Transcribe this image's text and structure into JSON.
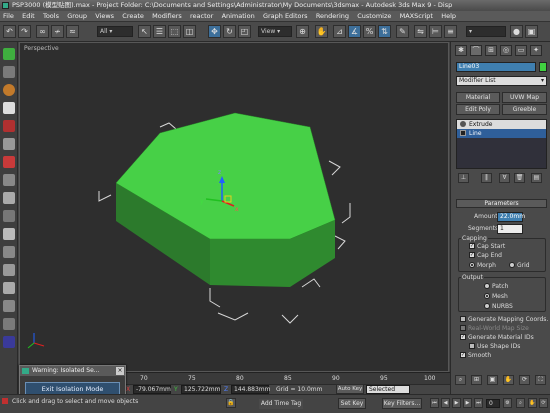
{
  "window": {
    "title": "PSP3000 (模型贴图).max  - Project Folder: C:\\Documents and Settings\\Administrator\\My Documents\\3dsmax  - Autodesk 3ds Max 9  - Disp"
  },
  "menu": {
    "items": [
      "File",
      "Edit",
      "Tools",
      "Group",
      "Views",
      "Create",
      "Modifiers",
      "reactor",
      "Animation",
      "Graph Editors",
      "Rendering",
      "Customize",
      "MAXScript",
      "Help"
    ]
  },
  "toolbar": {
    "selection_filter": "All",
    "coord_system": "View"
  },
  "viewport": {
    "label": "Perspective"
  },
  "command_panel": {
    "object_name": "Line03",
    "object_color": "#40d040",
    "modifier_list_label": "Modifier List",
    "buttons": [
      "Material",
      "UVW Map",
      "Edit Poly",
      "Greeble"
    ],
    "stack": [
      "Extrude",
      "Line"
    ],
    "parameters_title": "Parameters",
    "amount_label": "Amount:",
    "amount_value": "22.0mm",
    "segments_label": "Segments:",
    "segments_value": "1",
    "capping_title": "Capping",
    "cap_start": "Cap Start",
    "cap_end": "Cap End",
    "morph": "Morph",
    "grid": "Grid",
    "output_title": "Output",
    "patch": "Patch",
    "mesh": "Mesh",
    "nurbs": "NURBS",
    "gen_mapping": "Generate Mapping Coords.",
    "real_world": "Real-World Map Size",
    "gen_material_ids": "Generate Material IDs",
    "use_shape_ids": "Use Shape IDs",
    "smooth": "Smooth"
  },
  "isolation": {
    "title": "Warning: Isolated Se...",
    "exit_button": "Exit Isolation Mode"
  },
  "timeline": {
    "ticks": [
      "70",
      "75",
      "80",
      "85",
      "90",
      "95",
      "100"
    ]
  },
  "status": {
    "message": "Click and drag to select and move objects",
    "x_label": "X",
    "x_value": "-79.067mm",
    "y_label": "Y",
    "y_value": "125.722mm",
    "z_label": "Z",
    "z_value": "144.883mm",
    "grid": "Grid = 10.0mm",
    "add_time_tag": "Add Time Tag",
    "auto_key": "Auto Key",
    "set_key": "Set Key",
    "key_selected": "Selected",
    "key_filters": "Key Filters...",
    "frame_value": "0"
  },
  "colors": {
    "object_green": "#47d047",
    "object_side": "#2f8a2f",
    "viewport_bg": "#2e2e2e",
    "accent_blue": "#3d6f9a"
  }
}
